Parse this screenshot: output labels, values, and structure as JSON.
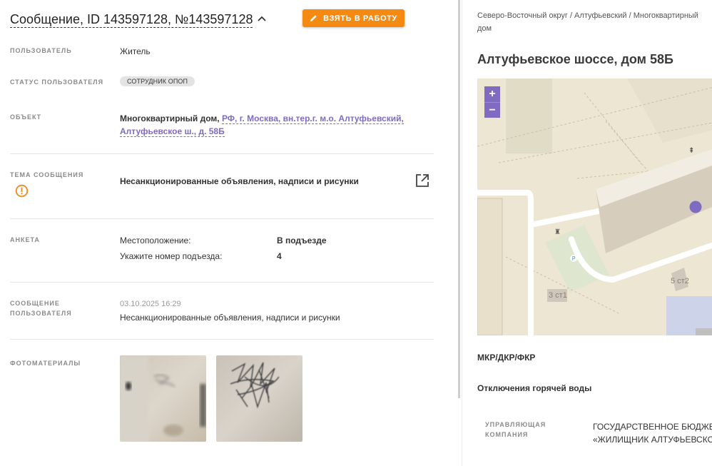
{
  "header": {
    "title": "Сообщение, ID 143597128, №143597128",
    "take_button_label": "ВЗЯТЬ В РАБОТУ"
  },
  "fields": {
    "user_label": "ПОЛЬЗОВАТЕЛЬ",
    "user_value": "Житель",
    "user_status_label": "СТАТУС ПОЛЬЗОВАТЕЛЯ",
    "user_status_badge": "СОТРУДНИК ОПОП",
    "object_label": "ОБЪЕКТ",
    "object_type": "Многоквартирный дом,",
    "object_address": "РФ, г. Москва, вн.тер.г. м.о. Алтуфьевский, Алтуфьевское ш., д. 58Б",
    "topic_label": "ТЕМА СООБЩЕНИЯ",
    "topic_value": "Несанкционированные объявления, надписи и рисунки",
    "survey_label": "АНКЕТА",
    "survey_rows": [
      {
        "q": "Местоположение:",
        "a": "В подъезде"
      },
      {
        "q": "Укажите номер подъезда:",
        "a": "4"
      }
    ],
    "user_message_label": "СООБЩЕНИЕ ПОЛЬЗОВАТЕЛЯ",
    "user_message_date": "03.10.2025 16:29",
    "user_message_text": "Несанкционированные объявления, надписи и рисунки",
    "photos_label": "ФОТОМАТЕРИАЛЫ"
  },
  "right": {
    "breadcrumb": "Северо-Восточный округ / Алтуфьевский / Многоквартирный дом",
    "address_title": "Алтуфьевское шоссе, дом 58Б",
    "map": {
      "zoom_in": "+",
      "zoom_out": "−",
      "labels": [
        "5 ст2",
        "3 ст1"
      ],
      "parking_label": "P"
    },
    "items": [
      "МКР/ДКР/ФКР",
      "Отключения горячей воды"
    ],
    "company_label": "УПРАВЛЯЮЩАЯ КОМПАНИЯ",
    "company_value_line1": "ГОСУДАРСТВЕННОЕ БЮДЖЕ",
    "company_value_line2": "«ЖИЛИЩНИК АЛТУФЬЕВСКО"
  },
  "colors": {
    "accent": "#7f6bc2",
    "button": "#f58a12",
    "warning": "#f08a1c"
  },
  "icons": [
    "chevron-up-icon",
    "pencil-icon",
    "warning-icon",
    "external-link-icon"
  ]
}
